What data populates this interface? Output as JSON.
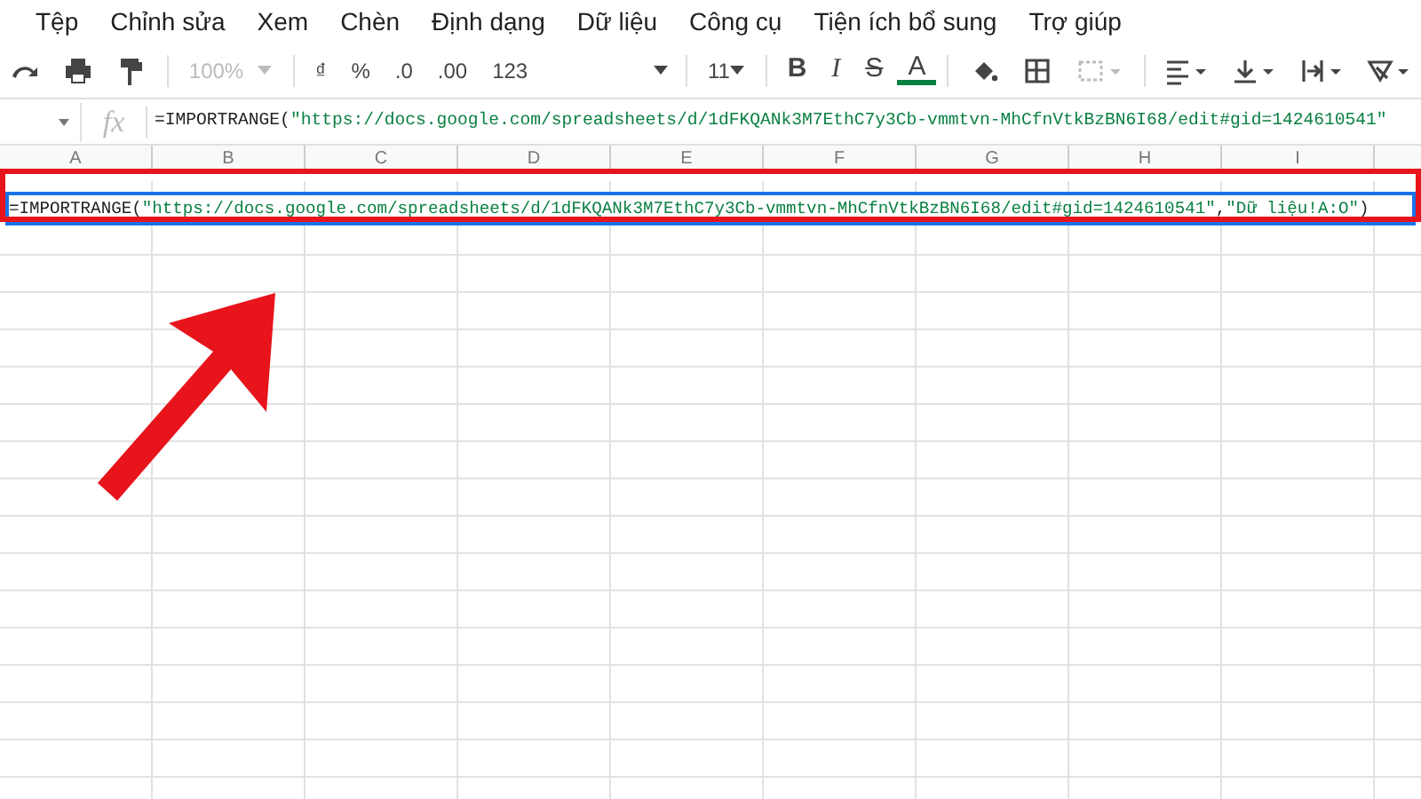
{
  "menu": [
    "Tệp",
    "Chỉnh sửa",
    "Xem",
    "Chèn",
    "Định dạng",
    "Dữ liệu",
    "Công cụ",
    "Tiện ích bổ sung",
    "Trợ giúp"
  ],
  "toolbar": {
    "zoom": {
      "text": "100%",
      "disabled": true
    },
    "number_formats": [
      "₫",
      "%",
      ".0",
      ".00",
      "123"
    ],
    "font_size": "11",
    "text_styles": [
      "B",
      "I",
      "S",
      "A"
    ]
  },
  "formula_bar": {
    "fx": "fx",
    "parts": [
      {
        "kind": "plain",
        "text": "=IMPORTRANGE("
      },
      {
        "kind": "string",
        "text": "\"https://docs.google.com/spreadsheets/d/1dFKQANk3M7EthC7y3Cb-vmmtvn-MhCfnVtkBzBN6I68/edit#gid=1424610541\""
      }
    ]
  },
  "columns": [
    "A",
    "B",
    "C",
    "D",
    "E",
    "F",
    "G",
    "H",
    "I"
  ],
  "cell_editor": {
    "parts": [
      {
        "kind": "plain",
        "text": "=IMPORTRANGE("
      },
      {
        "kind": "string",
        "text": "\"https://docs.google.com/spreadsheets/d/1dFKQANk3M7EthC7y3Cb-vmmtvn-MhCfnVtkBzBN6I68/edit#gid=1424610541\""
      },
      {
        "kind": "plain",
        "text": ","
      },
      {
        "kind": "string",
        "text": "\"Dữ liệu!A:O\""
      },
      {
        "kind": "plain",
        "text": ")"
      }
    ]
  }
}
